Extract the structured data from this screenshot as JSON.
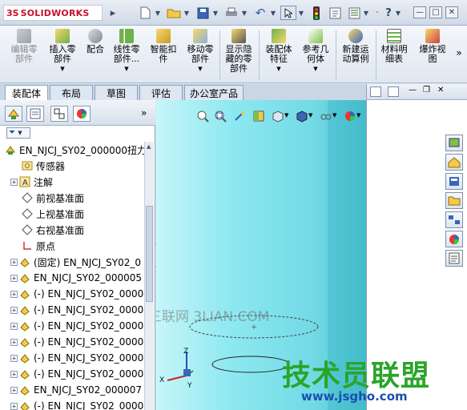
{
  "app": {
    "brand_ds": "3S",
    "brand_name": "SOLIDWORKS"
  },
  "ribbon": {
    "buttons": [
      {
        "label": "编辑零\n部件",
        "disabled": true
      },
      {
        "label": "插入零\n部件",
        "arrow": "▼"
      },
      {
        "label": "配合"
      },
      {
        "label": "线性零\n部件...",
        "arrow": "▼"
      },
      {
        "label": "智能扣\n件"
      },
      {
        "label": "移动零\n部件",
        "arrow": "▼"
      },
      {
        "label": "显示隐\n藏的零\n部件"
      },
      {
        "label": "装配体\n特征",
        "arrow": "▼"
      },
      {
        "label": "参考几\n何体",
        "arrow": "▼"
      },
      {
        "label": "新建运\n动算例"
      },
      {
        "label": "材料明\n细表"
      },
      {
        "label": "爆炸视\n图"
      }
    ],
    "more": "»"
  },
  "tabs": [
    {
      "label": "装配体",
      "active": true
    },
    {
      "label": "布局"
    },
    {
      "label": "草图"
    },
    {
      "label": "评估"
    },
    {
      "label": "办公室产品"
    }
  ],
  "panel": {
    "more": "»",
    "filter": "▼"
  },
  "tree": [
    {
      "label": "EN_NJCJ_SY02_000000扭力",
      "icon": "assembly-icon",
      "expander": ""
    },
    {
      "label": "传感器",
      "icon": "sensor-icon",
      "expander": ""
    },
    {
      "label": "注解",
      "icon": "annotation-icon",
      "expander": "+"
    },
    {
      "label": "前视基准面",
      "icon": "plane-icon",
      "expander": ""
    },
    {
      "label": "上视基准面",
      "icon": "plane-icon",
      "expander": ""
    },
    {
      "label": "右视基准面",
      "icon": "plane-icon",
      "expander": ""
    },
    {
      "label": "原点",
      "icon": "origin-icon",
      "expander": ""
    },
    {
      "label": "(固定) EN_NJCJ_SY02_0",
      "icon": "part-icon",
      "expander": "+"
    },
    {
      "label": "EN_NJCJ_SY02_000005",
      "icon": "part-icon",
      "expander": "+"
    },
    {
      "label": "(-) EN_NJCJ_SY02_0000",
      "icon": "part-icon",
      "expander": "+"
    },
    {
      "label": "(-) EN_NJCJ_SY02_0000",
      "icon": "part-icon",
      "expander": "+"
    },
    {
      "label": "(-) EN_NJCJ_SY02_0000",
      "icon": "part-icon",
      "expander": "+"
    },
    {
      "label": "(-) EN_NJCJ_SY02_0000",
      "icon": "part-icon",
      "expander": "+"
    },
    {
      "label": "(-) EN_NJCJ_SY02_0000",
      "icon": "part-icon",
      "expander": "+"
    },
    {
      "label": "(-) EN_NJCJ_SY02_0000",
      "icon": "part-icon",
      "expander": "+"
    },
    {
      "label": "EN_NJCJ_SY02_000007",
      "icon": "part-icon",
      "expander": "+"
    },
    {
      "label": "(-) EN_NJCJ_SY02_0000",
      "icon": "part-icon",
      "expander": "+"
    }
  ],
  "viewport": {
    "triad": {
      "x": "X",
      "y": "Y",
      "z": "Z"
    },
    "watermark": "三联网 3LIAN.COM",
    "brand": {
      "cn": "技术员联盟",
      "url": "www.jsgho.com"
    }
  },
  "colors": {
    "brand_red": "#c8102e",
    "viewport_cyan": "#5fd5e2",
    "brand_green": "#2aa52a",
    "brand_blue": "#1a4fb0"
  }
}
